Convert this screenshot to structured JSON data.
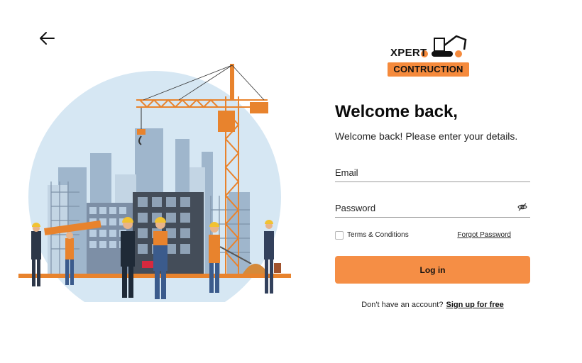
{
  "logo": {
    "top_text": "XPERT",
    "bar_text": "CONTRUCTION"
  },
  "form": {
    "title": "Welcome back,",
    "subtitle": "Welcome back! Please enter your details.",
    "email_placeholder": "Email",
    "password_placeholder": "Password",
    "terms_label": "Terms & Conditions",
    "forgot_label": "Forgot Password",
    "login_label": "Log in",
    "no_account_text": "Don't have an account?",
    "signup_label": "Sign up for free"
  },
  "colors": {
    "accent": "#f58e45",
    "sky": "#d6e7f3",
    "crane": "#e8832d"
  },
  "icons": {
    "back": "arrow-left-icon",
    "password_toggle": "eye-off-icon"
  }
}
